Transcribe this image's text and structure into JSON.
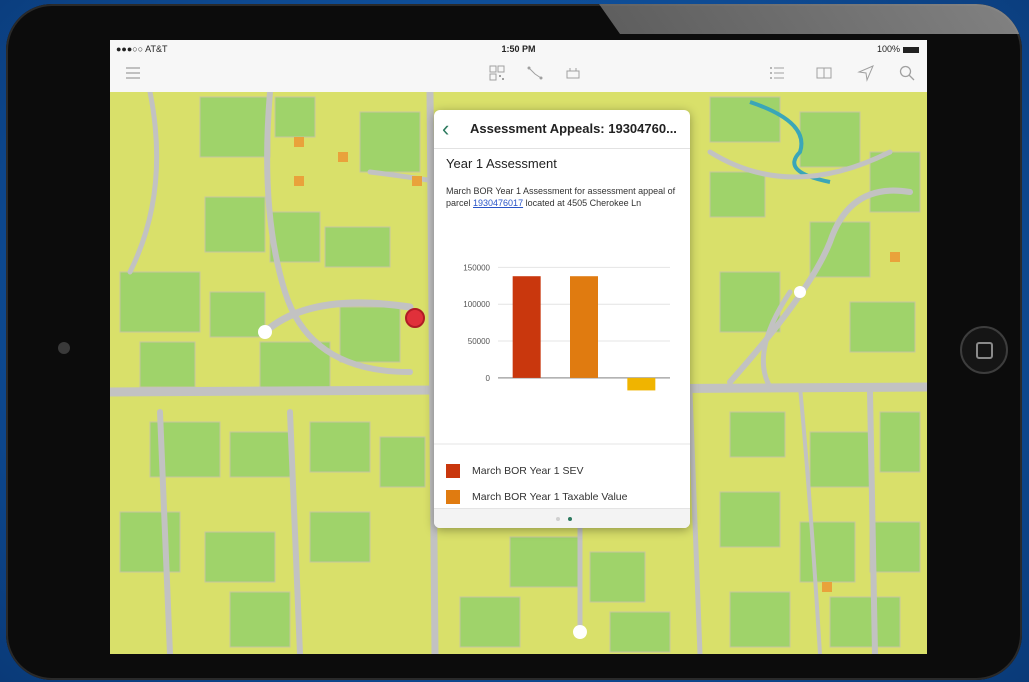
{
  "status": {
    "carrier": "●●●○○ AT&T",
    "time": "1:50 PM",
    "battery": "100%"
  },
  "toolbar": {
    "left_icons": [
      "menu-icon"
    ],
    "center_icons": [
      "qr-icon",
      "measure-icon",
      "layers-icon"
    ],
    "right_icons": [
      "list-icon",
      "book-icon",
      "locate-icon",
      "search-icon"
    ]
  },
  "popup": {
    "title": "Assessment Appeals: 19304760...",
    "section_title": "Year 1 Assessment",
    "desc_pre": "March BOR Year 1 Assessment for assessment appeal of parcel ",
    "desc_link": "1930476017",
    "desc_post": " located at 4505 Cherokee Ln",
    "page_count": 2,
    "active_page": 1
  },
  "chart_data": {
    "type": "bar",
    "categories": [
      "March BOR Year 1 SEV",
      "March BOR Year 1 Taxable Value",
      ""
    ],
    "values": [
      138000,
      138000,
      -17000
    ],
    "colors": [
      "#c9370d",
      "#e07b10",
      "#f0b400"
    ],
    "ylim": [
      -30000,
      160000
    ],
    "yticks": [
      0,
      50000,
      100000,
      150000
    ],
    "ytick_labels": [
      "0",
      "50000",
      "100000",
      "150000"
    ],
    "legend": [
      {
        "label": "March BOR Year 1 SEV",
        "color": "#c9370d"
      },
      {
        "label": "March BOR Year 1 Taxable Value",
        "color": "#e07b10"
      }
    ],
    "grid": true
  },
  "colors": {
    "accent": "#2d7a5f",
    "map_yellow": "#d9e06a",
    "map_green": "#9fd36a",
    "road": "#c2c2c2",
    "marker": "#e0303a"
  }
}
